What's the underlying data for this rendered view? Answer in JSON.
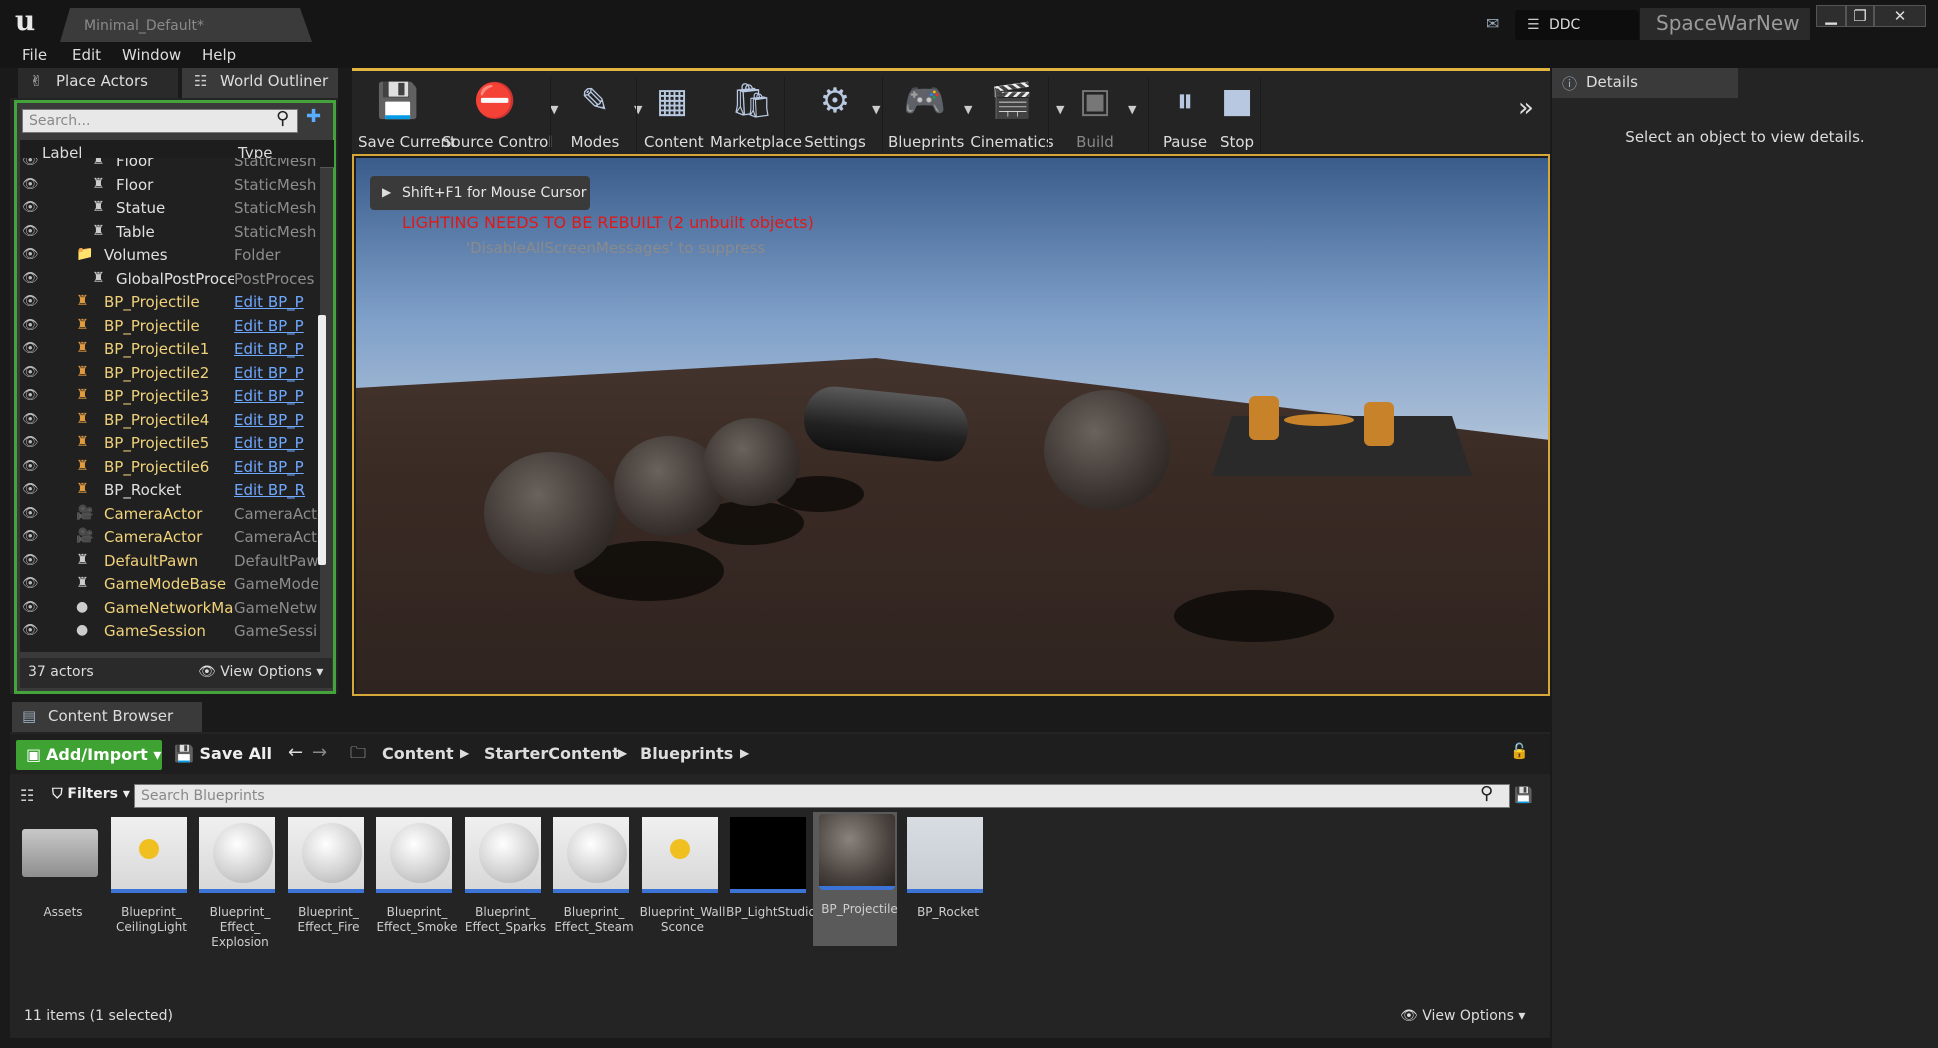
{
  "window": {
    "level_tab": "Minimal_Default*",
    "ddc_label": "DDC",
    "project_name": "SpaceWarNew",
    "min": "▁",
    "max": "❐",
    "close": "✕"
  },
  "menu": [
    "File",
    "Edit",
    "Window",
    "Help"
  ],
  "left_tabs": {
    "place_actors": "Place Actors",
    "world_outliner": "World Outliner"
  },
  "outliner": {
    "search_placeholder": "Search...",
    "col_label": "Label",
    "col_type": "Type",
    "rows": [
      {
        "label": "Floor",
        "type": "StaticMesh",
        "indent": 1,
        "color": "#e0e0e0",
        "icon": "staticmesh-icon",
        "link": false
      },
      {
        "label": "Floor",
        "type": "StaticMesh",
        "indent": 1,
        "color": "#e0e0e0",
        "icon": "staticmesh-icon",
        "link": false
      },
      {
        "label": "Statue",
        "type": "StaticMesh",
        "indent": 1,
        "color": "#e0e0e0",
        "icon": "staticmesh-icon",
        "link": false
      },
      {
        "label": "Table",
        "type": "StaticMesh",
        "indent": 1,
        "color": "#e0e0e0",
        "icon": "staticmesh-icon",
        "link": false
      },
      {
        "label": "Volumes",
        "type": "Folder",
        "indent": 0,
        "color": "#e0e0e0",
        "icon": "folder-icon",
        "link": false
      },
      {
        "label": "GlobalPostProce",
        "type": "PostProces",
        "indent": 1,
        "color": "#e0e0e0",
        "icon": "postprocess-icon",
        "link": false
      },
      {
        "label": "BP_Projectile",
        "type": "Edit BP_P",
        "indent": 0,
        "color": "#f0d27a",
        "icon": "blueprint-actor-icon",
        "link": true
      },
      {
        "label": "BP_Projectile",
        "type": "Edit BP_P",
        "indent": 0,
        "color": "#f0d27a",
        "icon": "blueprint-actor-icon",
        "link": true
      },
      {
        "label": "BP_Projectile1",
        "type": "Edit BP_P",
        "indent": 0,
        "color": "#f0d27a",
        "icon": "blueprint-actor-icon",
        "link": true
      },
      {
        "label": "BP_Projectile2",
        "type": "Edit BP_P",
        "indent": 0,
        "color": "#f0d27a",
        "icon": "blueprint-actor-icon",
        "link": true
      },
      {
        "label": "BP_Projectile3",
        "type": "Edit BP_P",
        "indent": 0,
        "color": "#f0d27a",
        "icon": "blueprint-actor-icon",
        "link": true
      },
      {
        "label": "BP_Projectile4",
        "type": "Edit BP_P",
        "indent": 0,
        "color": "#f0d27a",
        "icon": "blueprint-actor-icon",
        "link": true
      },
      {
        "label": "BP_Projectile5",
        "type": "Edit BP_P",
        "indent": 0,
        "color": "#f0d27a",
        "icon": "blueprint-actor-icon",
        "link": true
      },
      {
        "label": "BP_Projectile6",
        "type": "Edit BP_P",
        "indent": 0,
        "color": "#f0d27a",
        "icon": "blueprint-actor-icon",
        "link": true
      },
      {
        "label": "BP_Rocket",
        "type": "Edit BP_R",
        "indent": 0,
        "color": "#e0e0e0",
        "icon": "blueprint-actor-icon",
        "link": true
      },
      {
        "label": "CameraActor",
        "type": "CameraActo",
        "indent": 0,
        "color": "#f0d27a",
        "icon": "camera-icon",
        "link": false
      },
      {
        "label": "CameraActor",
        "type": "CameraActo",
        "indent": 0,
        "color": "#f0d27a",
        "icon": "camera-icon",
        "link": false
      },
      {
        "label": "DefaultPawn",
        "type": "DefaultPaw",
        "indent": 0,
        "color": "#f0d27a",
        "icon": "pawn-icon",
        "link": false
      },
      {
        "label": "GameModeBase",
        "type": "GameMode",
        "indent": 0,
        "color": "#f0d27a",
        "icon": "gamemode-icon",
        "link": false
      },
      {
        "label": "GameNetworkMana",
        "type": "GameNetwo",
        "indent": 0,
        "color": "#f0d27a",
        "icon": "sphere-icon",
        "link": false
      },
      {
        "label": "GameSession",
        "type": "GameSessi",
        "indent": 0,
        "color": "#f0d27a",
        "icon": "sphere-icon",
        "link": false
      }
    ],
    "actors_count": "37 actors",
    "view_options": "View Options"
  },
  "toolbar": [
    {
      "label": "Save Current",
      "icon": "save-icon",
      "glyph": "💾",
      "dropdown": false
    },
    {
      "label": "Source Control",
      "icon": "source-control-icon",
      "glyph": "⛔",
      "dropdown": true
    },
    {
      "label": "Modes",
      "icon": "modes-icon",
      "glyph": "✎",
      "dropdown": true
    },
    {
      "label": "Content",
      "icon": "content-icon",
      "glyph": "▦",
      "dropdown": false
    },
    {
      "label": "Marketplace",
      "icon": "marketplace-icon",
      "glyph": "🛍",
      "dropdown": false
    },
    {
      "label": "Settings",
      "icon": "settings-icon",
      "glyph": "⚙",
      "dropdown": true
    },
    {
      "label": "Blueprints",
      "icon": "blueprints-icon",
      "glyph": "🎮",
      "dropdown": true
    },
    {
      "label": "Cinematics",
      "icon": "cinematics-icon",
      "glyph": "🎬",
      "dropdown": true
    },
    {
      "label": "Build",
      "icon": "build-icon",
      "glyph": "▣",
      "dropdown": true
    },
    {
      "label": "Pause",
      "icon": "pause-icon",
      "glyph": "⏸",
      "dropdown": false
    },
    {
      "label": "Stop",
      "icon": "stop-icon",
      "glyph": "■",
      "dropdown": false
    }
  ],
  "viewport": {
    "hint": "Shift+F1 for Mouse Cursor",
    "lighting_warning": "LIGHTING NEEDS TO BE REBUILT (2 unbuilt objects)",
    "suppress_msg": "'DisableAllScreenMessages' to suppress"
  },
  "details": {
    "tab": "Details",
    "message": "Select an object to view details."
  },
  "content_browser": {
    "tab": "Content Browser",
    "add_import": "Add/Import",
    "save_all": "Save All",
    "breadcrumbs": [
      "Content",
      "StarterContent",
      "Blueprints"
    ],
    "filters": "Filters",
    "search_placeholder": "Search Blueprints",
    "assets": [
      {
        "name": "Assets",
        "kind": "folder"
      },
      {
        "name": "Blueprint_\nCeilingLight",
        "kind": "light"
      },
      {
        "name": "Blueprint_\nEffect_\nExplosion",
        "kind": "sphere"
      },
      {
        "name": "Blueprint_\nEffect_Fire",
        "kind": "sphere"
      },
      {
        "name": "Blueprint_\nEffect_Smoke",
        "kind": "sphere"
      },
      {
        "name": "Blueprint_\nEffect_Sparks",
        "kind": "sphere"
      },
      {
        "name": "Blueprint_\nEffect_Steam",
        "kind": "sphere"
      },
      {
        "name": "Blueprint_Wall\nSconce",
        "kind": "sconce"
      },
      {
        "name": "BP_LightStudio",
        "kind": "dark"
      },
      {
        "name": "BP_Projectile",
        "kind": "projectile",
        "selected": true
      },
      {
        "name": "BP_Rocket",
        "kind": "rocket"
      }
    ],
    "status": "11 items (1 selected)",
    "view_options": "View Options"
  },
  "colors": {
    "accent_green": "#44a33a",
    "toolbar_accent": "#e0b640",
    "viewport_border": "#d6a83a",
    "warning_red": "#e01818",
    "link_blue": "#6fa8ff"
  }
}
